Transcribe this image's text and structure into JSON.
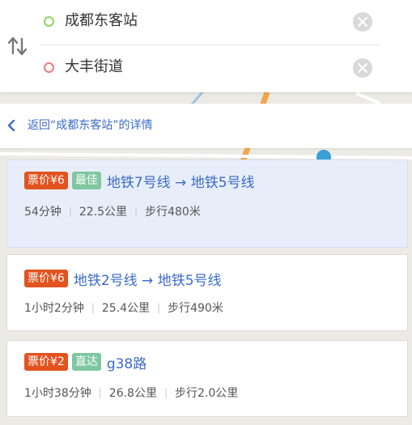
{
  "search": {
    "from": "成都东客站",
    "to": "大丰街道"
  },
  "back": {
    "label": "返回“成都东客站”的详情"
  },
  "routes": [
    {
      "price": "票价¥6",
      "badge": "最佳",
      "name": "地铁7号线 → 地铁5号线",
      "duration": "54分钟",
      "distance": "22.5公里",
      "walk": "步行480米",
      "selected": true
    },
    {
      "price": "票价¥6",
      "badge": "",
      "name": "地铁2号线 → 地铁5号线",
      "duration": "1小时2分钟",
      "distance": "25.4公里",
      "walk": "步行490米",
      "selected": false
    },
    {
      "price": "票价¥2",
      "badge": "直达",
      "name": "g38路",
      "duration": "1小时38分钟",
      "distance": "26.8公里",
      "walk": "步行2.0公里",
      "selected": false
    }
  ],
  "colors": {
    "price_tag": "#e2531f",
    "badge_tag": "#7fc79f",
    "link": "#3a6bc9",
    "selected_bg": "#e8eef9"
  }
}
